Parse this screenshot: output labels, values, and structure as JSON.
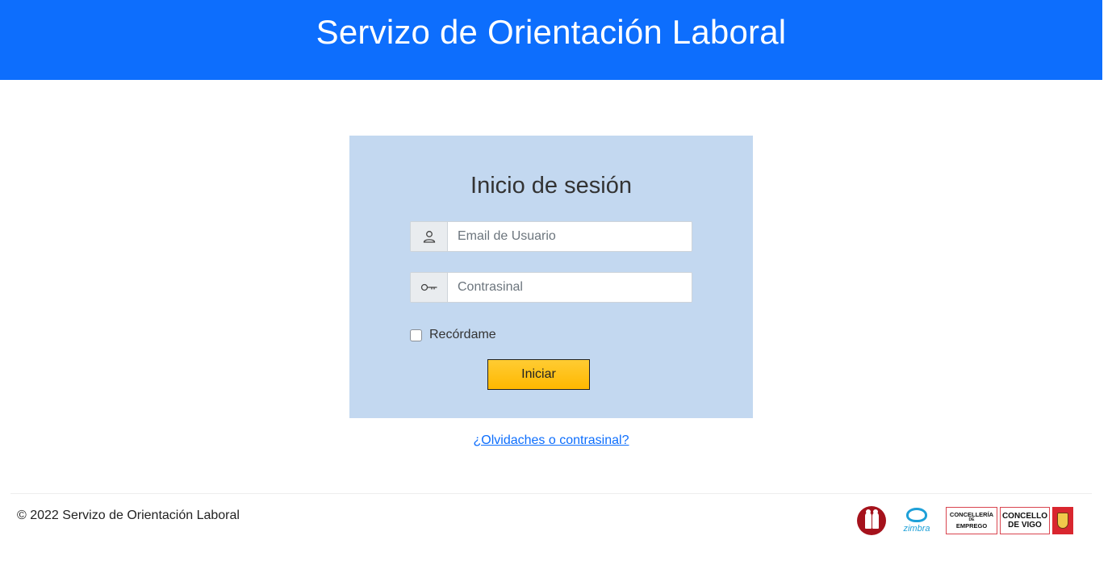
{
  "header": {
    "title": "Servizo de Orientación Laboral"
  },
  "login": {
    "title": "Inicio de sesión",
    "email_placeholder": "Email de Usuario",
    "password_placeholder": "Contrasinal",
    "remember_label": "Recórdame",
    "submit_label": "Iniciar",
    "forgot_link": "¿Olvidaches o contrasinal?"
  },
  "footer": {
    "copyright": "© 2022 Servizo de Orientación Laboral",
    "logos": {
      "zimbra": "zimbra",
      "concelleria_line1": "CONCELLERÍA",
      "concelleria_line2": "DE",
      "concelleria_line3": "EMPREGO",
      "concello_line1": "CONCELLO",
      "concello_line2": "DE VIGO"
    }
  },
  "colors": {
    "header_bg": "#0d6efd",
    "login_box_bg": "#c3d8f0",
    "button_bg": "#ffc107",
    "link": "#0d6efd"
  },
  "icons": {
    "user": "user-icon",
    "password": "key-icon"
  }
}
